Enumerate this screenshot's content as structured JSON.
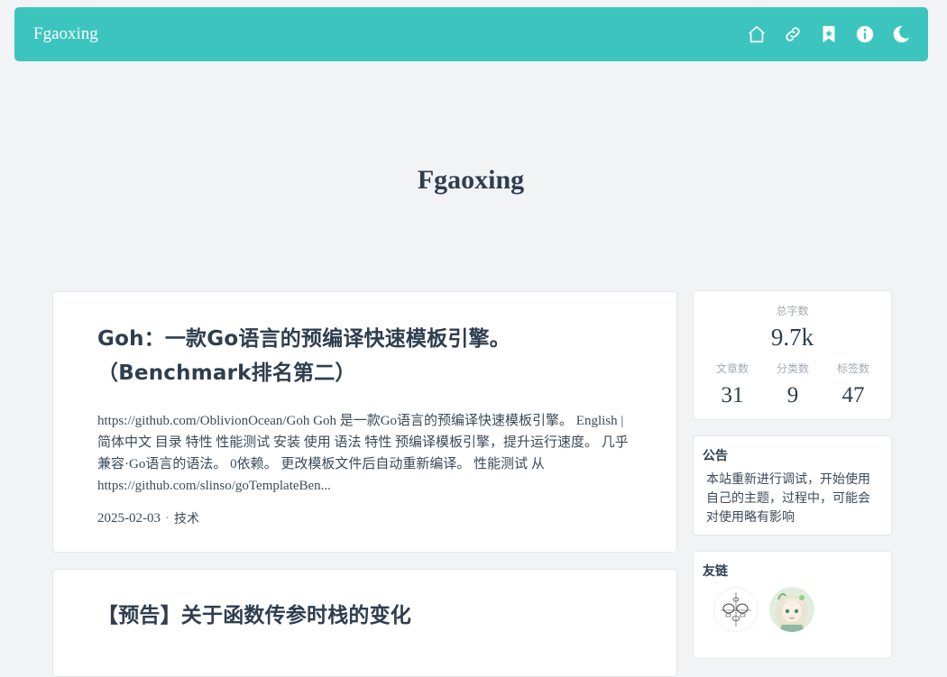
{
  "topbar": {
    "brand": "Fgaoxing",
    "icons": [
      "home-icon",
      "link-icon",
      "bookmark-icon",
      "info-icon",
      "moon-icon"
    ],
    "accent": "#3cc5bf"
  },
  "hero": {
    "title": "Fgaoxing"
  },
  "posts": [
    {
      "title_line1": "Goh：一款Go语言的预编译快速模板引擎。",
      "title_line2": "（Benchmark排名第二）",
      "excerpt": "https://github.com/OblivionOcean/Goh  Goh 是一款Go语言的预编译快速模板引擎。 English | 简体中文 目录  特性 性能测试 安装 使用 语法  特性  预编译模板引擎，提升运行速度。 几乎兼容·Go语言的语法。 0依赖。 更改模板文件后自动重新编译。  性能测试 从 https://github.com/slinso/goTemplateBen...",
      "date": "2025-02-03",
      "separator": "·",
      "category": "技术"
    },
    {
      "title_line1": "【预告】关于函数传参时栈的变化"
    }
  ],
  "stats": {
    "total_words_label": "总字数",
    "total_words": "9.7k",
    "articles_label": "文章数",
    "articles": "31",
    "categories_label": "分类数",
    "categories": "9",
    "tags_label": "标签数",
    "tags": "47"
  },
  "notice": {
    "title": "公告",
    "text": "本站重新进行调试，开始使用自己的主题，过程中，可能会对使用略有影响"
  },
  "friends": {
    "title": "友链"
  }
}
